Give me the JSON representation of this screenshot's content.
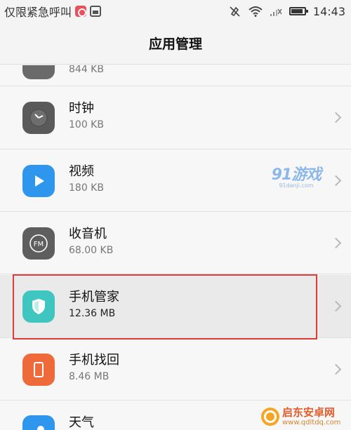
{
  "status_bar": {
    "carrier_text": "仅限紧急呼叫",
    "time": "14:43"
  },
  "header": {
    "title": "应用管理"
  },
  "apps": [
    {
      "name": "",
      "size": "844 KB",
      "icon": "app-icon-partial"
    },
    {
      "name": "时钟",
      "size": "100 KB",
      "icon": "clock-icon"
    },
    {
      "name": "视频",
      "size": "180 KB",
      "icon": "video-play-icon"
    },
    {
      "name": "收音机",
      "size": "68.00 KB",
      "icon": "fm-radio-icon"
    },
    {
      "name": "手机管家",
      "size": "12.36 MB",
      "icon": "shield-icon"
    },
    {
      "name": "手机找回",
      "size": "8.46 MB",
      "icon": "phone-finder-icon"
    },
    {
      "name": "天气",
      "size": "",
      "icon": "weather-icon"
    }
  ],
  "watermarks": {
    "site_91_main": "91游戏",
    "site_91_sub": "91danji.com",
    "brand_name": "启东安卓网",
    "brand_url": "www.qdltdq.com"
  },
  "colors": {
    "highlight": "#e03b3b",
    "video": "#2f96ee",
    "shield": "#3fc6c0",
    "phone_finder": "#ef6a3b",
    "clock": "#555555"
  }
}
